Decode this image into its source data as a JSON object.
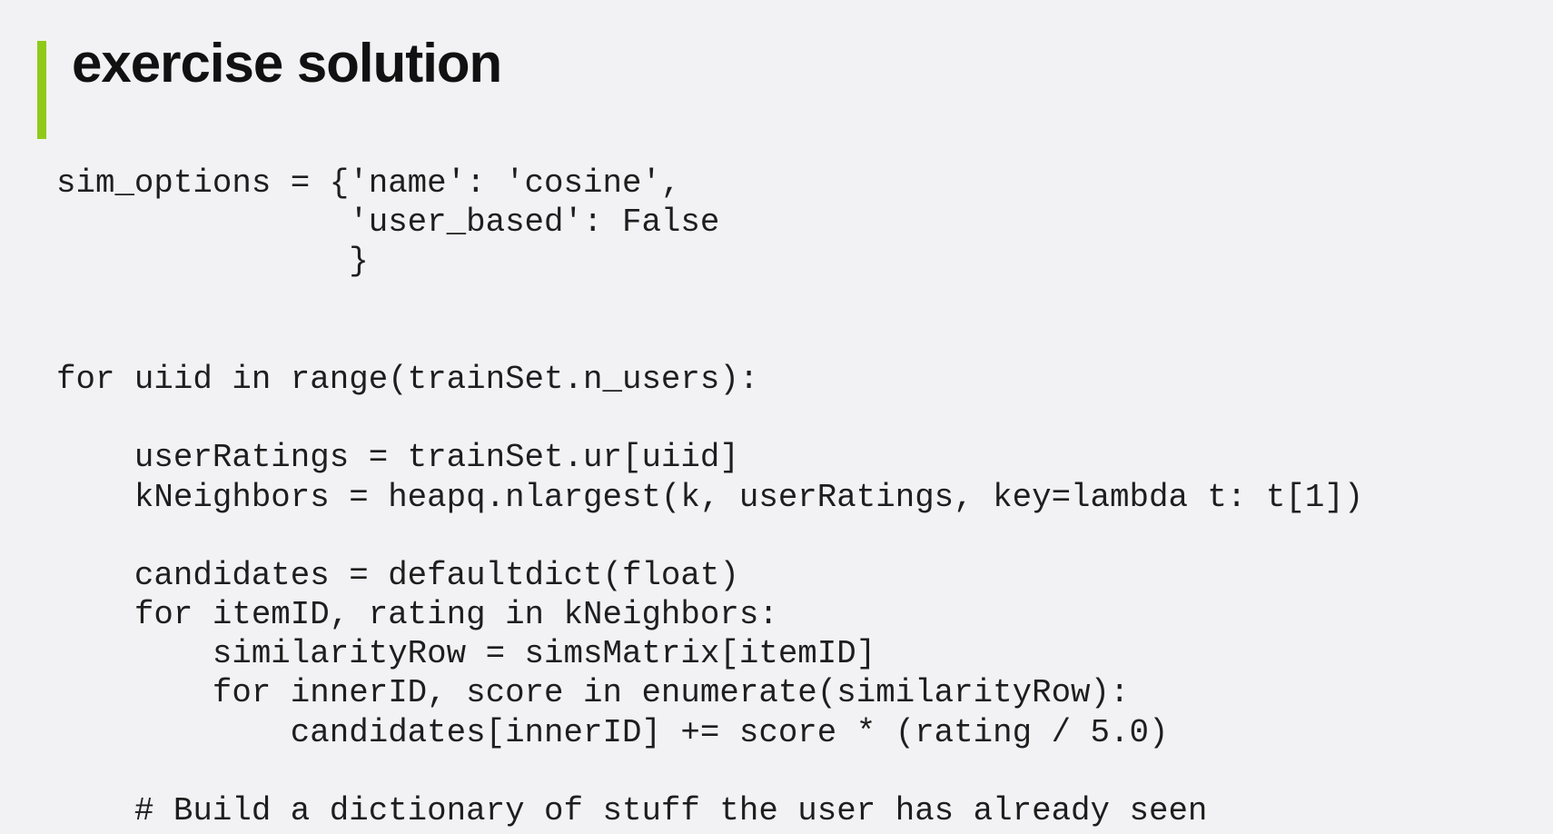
{
  "slide": {
    "title": "exercise solution",
    "accent_color": "#8fca1a",
    "code_lines": [
      "sim_options = {'name': 'cosine',",
      "               'user_based': False",
      "               }",
      "",
      "",
      "for uiid in range(trainSet.n_users):",
      "",
      "    userRatings = trainSet.ur[uiid]",
      "    kNeighbors = heapq.nlargest(k, userRatings, key=lambda t: t[1])",
      "",
      "    candidates = defaultdict(float)",
      "    for itemID, rating in kNeighbors:",
      "        similarityRow = simsMatrix[itemID]",
      "        for innerID, score in enumerate(similarityRow):",
      "            candidates[innerID] += score * (rating / 5.0)",
      "",
      "    # Build a dictionary of stuff the user has already seen"
    ]
  }
}
